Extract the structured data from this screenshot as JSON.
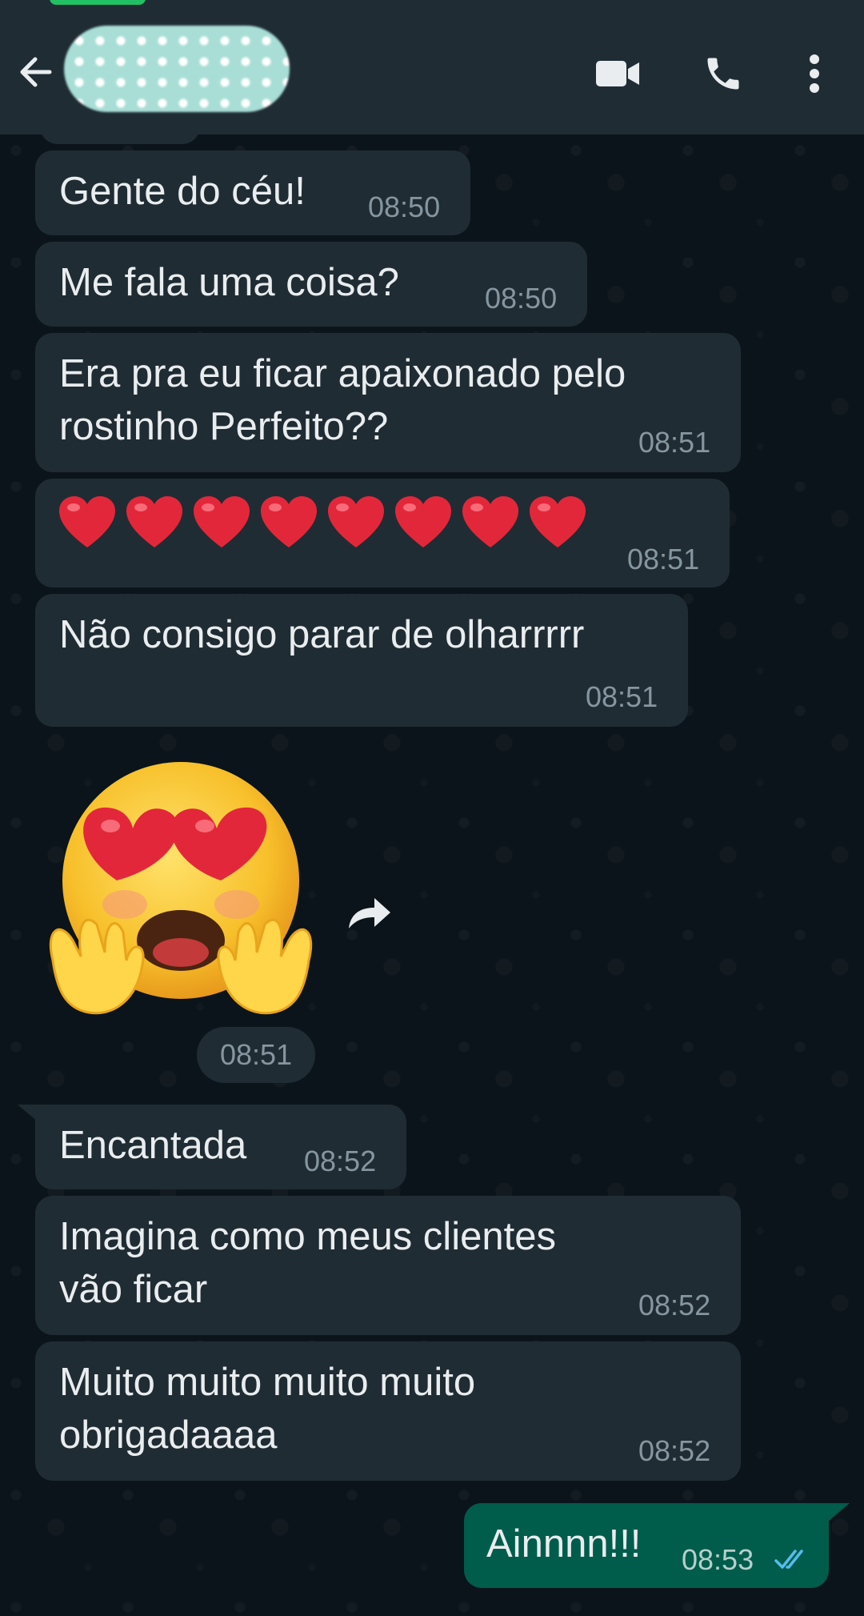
{
  "header": {
    "back_icon": "arrow-left-icon",
    "video_icon": "video-camera-icon",
    "call_icon": "phone-icon",
    "menu_icon": "more-vertical-icon",
    "accent": "#1f2c34"
  },
  "messages": [
    {
      "text": "Gente do céu!",
      "time": "08:50"
    },
    {
      "text": "Me fala uma coisa?",
      "time": "08:50"
    },
    {
      "line1": "Era pra eu ficar apaixonado pelo",
      "line2": "rostinho Perfeito??",
      "time": "08:51"
    },
    {
      "emoji": "red-heart x8",
      "time": "08:51"
    },
    {
      "text": "Não consigo parar de olharrrrr",
      "time": "08:51"
    },
    {
      "sticker": "heart-eyes-hands-sticker",
      "time": "08:51"
    },
    {
      "text": "Encantada",
      "time": "08:52"
    },
    {
      "line1": "Imagina como meus clientes",
      "line2": "vão ficar",
      "time": "08:52"
    },
    {
      "line1": "Muito muito muito muito",
      "line2": "obrigadaaaa",
      "time": "08:52"
    },
    {
      "text": "Ainnnn!!!",
      "time": "08:53",
      "status": "read-double-check"
    }
  ],
  "colors": {
    "incoming_bubble": "#202c33",
    "outgoing_bubble": "#005c4b",
    "read_ticks": "#53bdeb",
    "background": "#0b141a"
  }
}
